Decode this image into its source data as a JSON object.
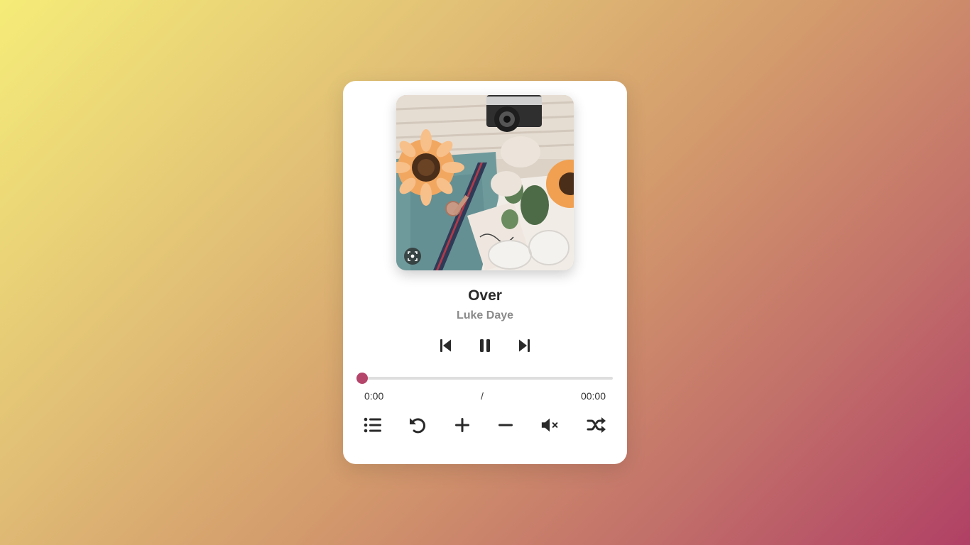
{
  "player": {
    "title": "Over",
    "artist": "Luke Daye",
    "current_time": "0:00",
    "separator": "/",
    "duration": "00:00",
    "progress": 0,
    "accent_color": "#b5456a",
    "state": "playing"
  },
  "icons": {
    "prev": "skip-previous-icon",
    "play_pause": "pause-icon",
    "next": "skip-next-icon",
    "playlist": "list-icon",
    "repeat": "undo-icon",
    "volume_up": "plus-icon",
    "volume_down": "minus-icon",
    "mute": "volume-mute-icon",
    "shuffle": "shuffle-icon",
    "lens": "lens-icon"
  }
}
